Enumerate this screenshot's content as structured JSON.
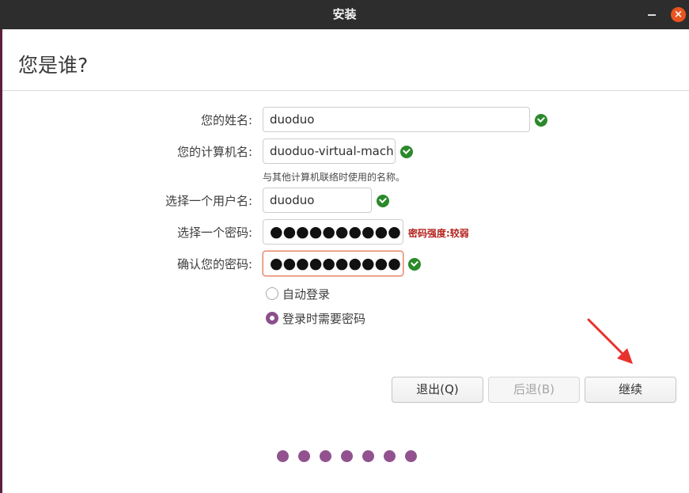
{
  "window": {
    "title": "安装"
  },
  "page": {
    "heading": "您是谁?"
  },
  "form": {
    "name": {
      "label": "您的姓名:",
      "value": "duoduo"
    },
    "computer": {
      "label": "您的计算机名:",
      "value": "duoduo-virtual-machin",
      "hint": "与其他计算机联络时使用的名称。"
    },
    "username": {
      "label": "选择一个用户名:",
      "value": "duoduo"
    },
    "password": {
      "label": "选择一个密码:",
      "value": "●●●●●●●●●●",
      "strength": "密码强度:较弱"
    },
    "confirm": {
      "label": "确认您的密码:",
      "value": "●●●●●●●●●●"
    }
  },
  "login": {
    "auto_login": {
      "label": "自动登录",
      "selected": false
    },
    "require_password": {
      "label": "登录时需要密码",
      "selected": true
    }
  },
  "buttons": {
    "quit": "退出(Q)",
    "back": "后退(B)",
    "continue": "继续"
  },
  "progress": {
    "total_steps": 7
  },
  "colors": {
    "accent": "#91528f",
    "close": "#e95420",
    "valid": "#2a8a2a",
    "warning": "#b3221d",
    "annotation": "#e8322d"
  }
}
